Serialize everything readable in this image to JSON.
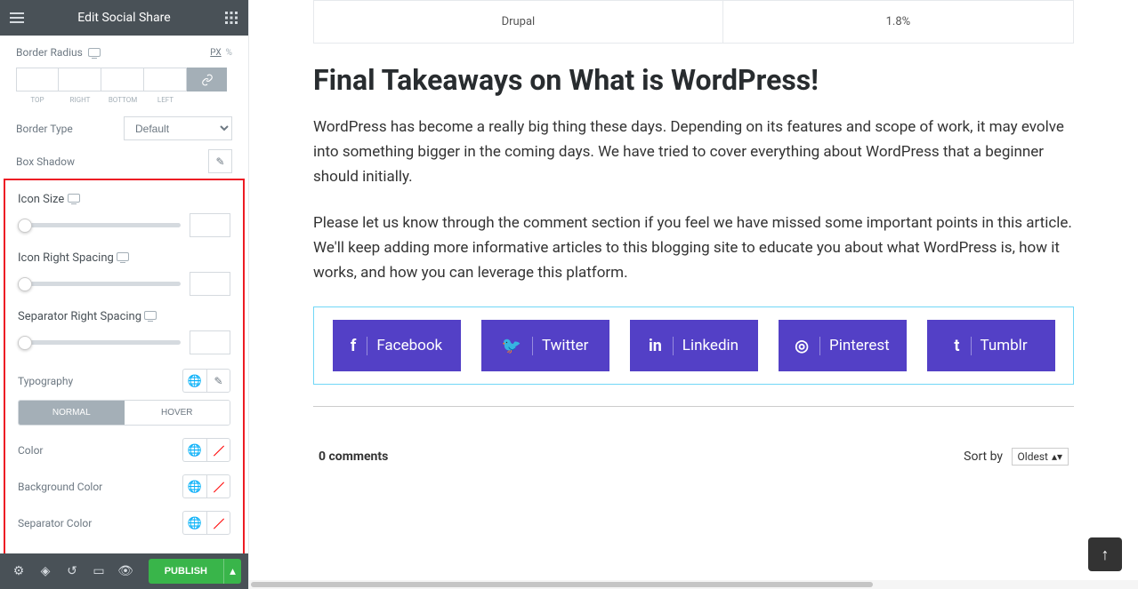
{
  "header": {
    "title": "Edit Social Share"
  },
  "border_radius": {
    "label": "Border Radius",
    "units": [
      "PX",
      "%"
    ],
    "active_unit": "PX",
    "sides": [
      "TOP",
      "RIGHT",
      "BOTTOM",
      "LEFT"
    ]
  },
  "border_type": {
    "label": "Border Type",
    "value": "Default"
  },
  "box_shadow": {
    "label": "Box Shadow"
  },
  "icon_size": {
    "label": "Icon Size"
  },
  "icon_right_spacing": {
    "label": "Icon Right Spacing"
  },
  "separator_right_spacing": {
    "label": "Separator Right Spacing"
  },
  "typography": {
    "label": "Typography"
  },
  "state_tabs": {
    "normal": "NORMAL",
    "hover": "HOVER"
  },
  "colors": {
    "color": "Color",
    "bg": "Background Color",
    "sep": "Separator Color"
  },
  "footer": {
    "publish": "PUBLISH"
  },
  "table": {
    "col1": "Drupal",
    "col2": "1.8%"
  },
  "article": {
    "title": "Final Takeaways on What is WordPress!",
    "p1": "WordPress has become a really big thing these days. Depending on its features and scope of work, it may evolve into something bigger in the coming days. We have tried to cover everything about WordPress that a beginner should initially.",
    "p2": "Please let us know through the comment section if you feel we have missed some important points in this article. We'll keep adding more informative articles to this blogging site to educate you about what WordPress is, how it works, and how you can leverage this platform."
  },
  "social": {
    "facebook": "Facebook",
    "twitter": "Twitter",
    "linkedin": "Linkedin",
    "pinterest": "Pinterest",
    "tumblr": "Tumblr"
  },
  "comments": {
    "count": "0 comments",
    "sort_label": "Sort by",
    "sort_value": "Oldest"
  }
}
